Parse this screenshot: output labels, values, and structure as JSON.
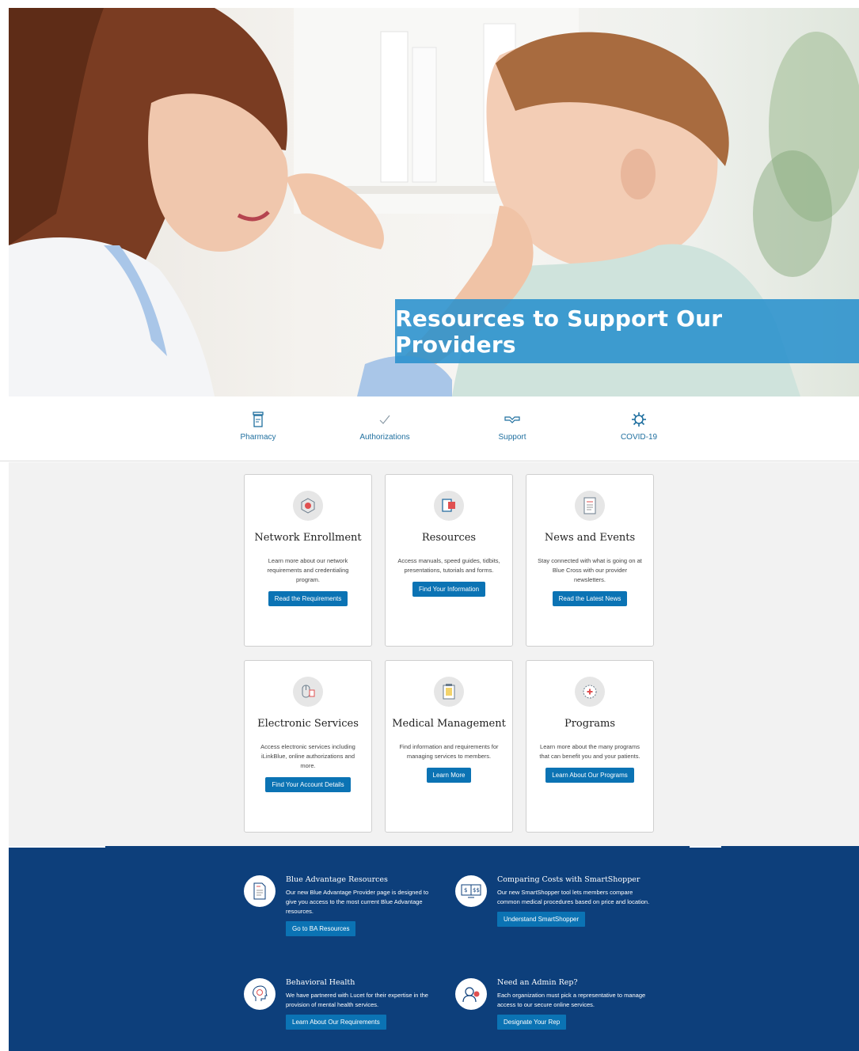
{
  "hero": {
    "title": "Resources to Support Our Providers"
  },
  "quick_nav": [
    {
      "label": "Pharmacy",
      "icon": "pharmacy-bottle-icon"
    },
    {
      "label": "Authorizations",
      "icon": "checkmark-icon"
    },
    {
      "label": "Support",
      "icon": "handshake-icon"
    },
    {
      "label": "COVID-19",
      "icon": "virus-icon"
    }
  ],
  "cards": [
    {
      "title": "Network Enrollment",
      "text": "Learn more about our network requirements and credentialing program.",
      "button": "Read the Requirements",
      "icon": "network-icon"
    },
    {
      "title": "Resources",
      "text": "Access manuals, speed guides, tidbits, presentations, tutorials and forms.",
      "button": "Find Your Information",
      "icon": "book-icon"
    },
    {
      "title": "News and Events",
      "text": "Stay connected with what is going on at Blue Cross with our provider newsletters.",
      "button": "Read the Latest News",
      "icon": "newsletter-icon"
    },
    {
      "title": "Electronic Services",
      "text": "Access electronic services including iLinkBlue, online authorizations and more.",
      "button": "Find Your Account Details",
      "icon": "mouse-icon"
    },
    {
      "title": "Medical Management",
      "text": "Find information and requirements for managing services to members.",
      "button": "Learn More",
      "icon": "clipboard-icon"
    },
    {
      "title": "Programs",
      "text": "Learn more about the many programs that can benefit you and your patients.",
      "button": "Learn About Our Programs",
      "icon": "medical-badge-icon"
    }
  ],
  "promos": [
    {
      "title": "Blue Advantage Resources",
      "text": "Our new Blue Advantage Provider page is designed to give you access to the most current Blue Advantage resources.",
      "button": "Go to BA Resources",
      "icon": "document-icon"
    },
    {
      "title": "Comparing Costs with SmartShopper",
      "text": "Our new SmartShopper tool lets members compare common medical procedures based on price and location.",
      "button": "Understand SmartShopper",
      "icon": "price-compare-icon"
    },
    {
      "title": "Behavioral Health",
      "text": "We have partnered with Lucet for their expertise in the provision of mental health services.",
      "button": "Learn About Our Requirements",
      "icon": "head-heart-icon"
    },
    {
      "title": "Need an Admin Rep?",
      "text": "Each organization must pick a representative to manage access to our secure online services.",
      "button": "Designate Your Rep",
      "icon": "admin-person-icon"
    }
  ],
  "colors": {
    "accent": "#0b73b4",
    "banner": "#2991cd",
    "navy": "#0d3f7b",
    "card_bg": "#f2f2f2"
  }
}
